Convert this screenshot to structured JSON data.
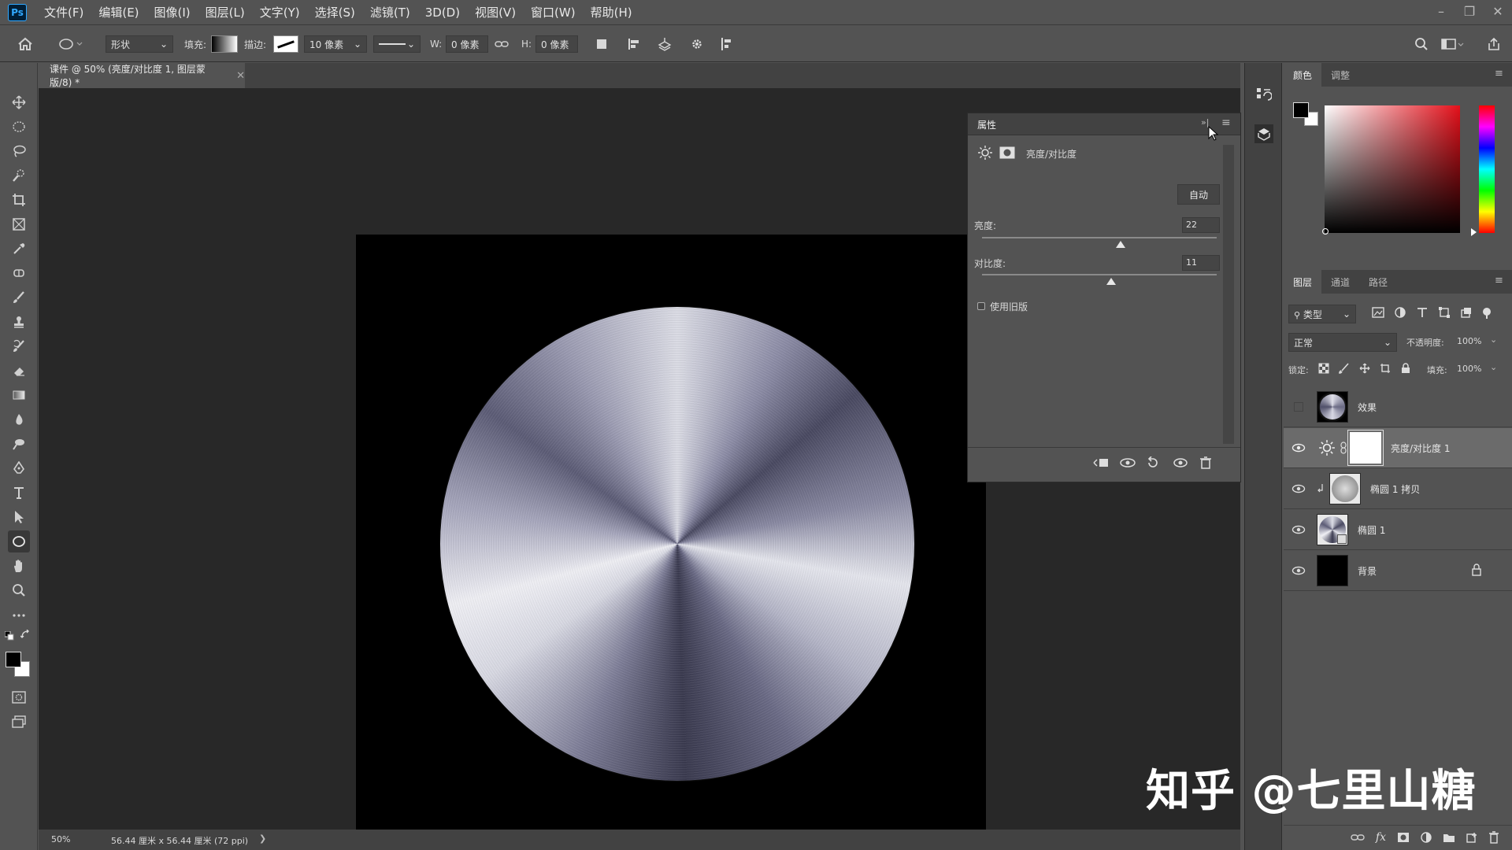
{
  "menu": [
    "文件(F)",
    "编辑(E)",
    "图像(I)",
    "图层(L)",
    "文字(Y)",
    "选择(S)",
    "滤镜(T)",
    "3D(D)",
    "视图(V)",
    "窗口(W)",
    "帮助(H)"
  ],
  "app_logo": "Ps",
  "options": {
    "mode": "形状",
    "fill_label": "填充:",
    "stroke_label": "描边:",
    "stroke_width": "10 像素",
    "w_label": "W:",
    "w_value": "0 像素",
    "h_label": "H:",
    "h_value": "0 像素"
  },
  "document": {
    "tab_title": "课件 @ 50% (亮度/对比度 1, 图层蒙版/8) *",
    "zoom": "50%",
    "doc_size": "56.44 厘米 x 56.44 厘米 (72 ppi)"
  },
  "properties": {
    "title": "属性",
    "adjust_name": "亮度/对比度",
    "auto_button": "自动",
    "brightness_label": "亮度:",
    "brightness_value": "22",
    "brightness_level": 0.59,
    "contrast_label": "对比度:",
    "contrast_value": "11",
    "contrast_level": 0.55,
    "legacy_label": "使用旧版"
  },
  "color_panel": {
    "tabs": [
      "颜色",
      "调整"
    ]
  },
  "layers_panel": {
    "tabs": [
      "图层",
      "通道",
      "路径"
    ],
    "filter_kind": "类型",
    "blend_mode": "正常",
    "opacity_label": "不透明度:",
    "opacity_value": "100%",
    "lock_label": "锁定:",
    "fill_label": "填充:",
    "fill_value": "100%",
    "layers": [
      {
        "name": "效果",
        "visible": false
      },
      {
        "name": "亮度/对比度 1",
        "visible": true
      },
      {
        "name": "椭圆 1 拷贝",
        "visible": true
      },
      {
        "name": "椭圆 1",
        "visible": true
      },
      {
        "name": "背景",
        "visible": true
      }
    ]
  },
  "watermark": "知乎 @七里山糖",
  "colors": {
    "accent": "#31a8ff",
    "panel": "#535353",
    "canvas": "#282828"
  }
}
